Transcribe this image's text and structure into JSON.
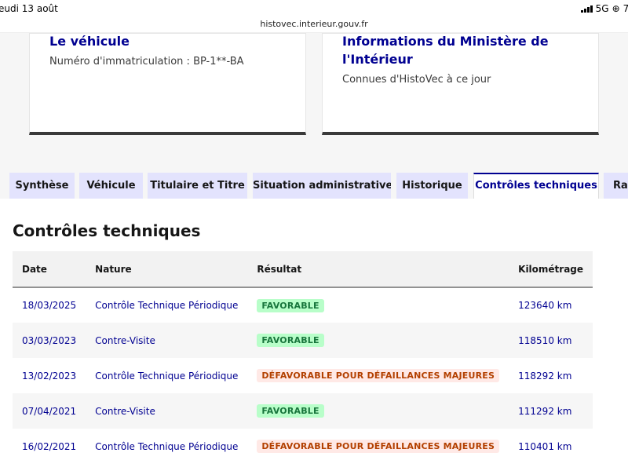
{
  "status_bar": {
    "time": "eudi 13 août",
    "network": "5G",
    "battery": "7("
  },
  "address_bar": {
    "url": "histovec.interieur.gouv.fr"
  },
  "cards": {
    "vehicle": {
      "title": "Le véhicule",
      "description": "Numéro d'immatriculation : BP-1**-BA"
    },
    "ministry": {
      "title": "Informations du Ministère de l'Intérieur",
      "description": "Connues d'HistoVec à ce jour"
    }
  },
  "tabs": [
    {
      "label": "Synthèse",
      "active": false
    },
    {
      "label": "Véhicule",
      "active": false
    },
    {
      "label": "Titulaire et Titre",
      "active": false
    },
    {
      "label": "Situation administrative",
      "active": false
    },
    {
      "label": "Historique",
      "active": false
    },
    {
      "label": "Contrôles techniques",
      "active": true
    },
    {
      "label": "Rap",
      "active": false
    }
  ],
  "panel": {
    "title": "Contrôles techniques",
    "columns": [
      "Date",
      "Nature",
      "Résultat",
      "Kilométrage"
    ],
    "rows": [
      {
        "date": "18/03/2025",
        "nature": "Contrôle Technique Périodique",
        "result": "FAVORABLE",
        "status": "ok",
        "km": "123640 km"
      },
      {
        "date": "03/03/2023",
        "nature": "Contre-Visite",
        "result": "FAVORABLE",
        "status": "ok",
        "km": "118510 km"
      },
      {
        "date": "13/02/2023",
        "nature": "Contrôle Technique Périodique",
        "result": "DÉFAVORABLE POUR DÉFAILLANCES MAJEURES",
        "status": "ko",
        "km": "118292 km"
      },
      {
        "date": "07/04/2021",
        "nature": "Contre-Visite",
        "result": "FAVORABLE",
        "status": "ok",
        "km": "111292 km"
      },
      {
        "date": "16/02/2021",
        "nature": "Contrôle Technique Périodique",
        "result": "DÉFAVORABLE POUR DÉFAILLANCES MAJEURES",
        "status": "ko",
        "km": "110401 km"
      }
    ]
  },
  "colors": {
    "brand_blue": "#000091",
    "tab_bg": "#e3e3fd",
    "ok_bg": "#b8fec9",
    "ok_text": "#18753c",
    "ko_bg": "#ffe9e6",
    "ko_text": "#b34000"
  }
}
